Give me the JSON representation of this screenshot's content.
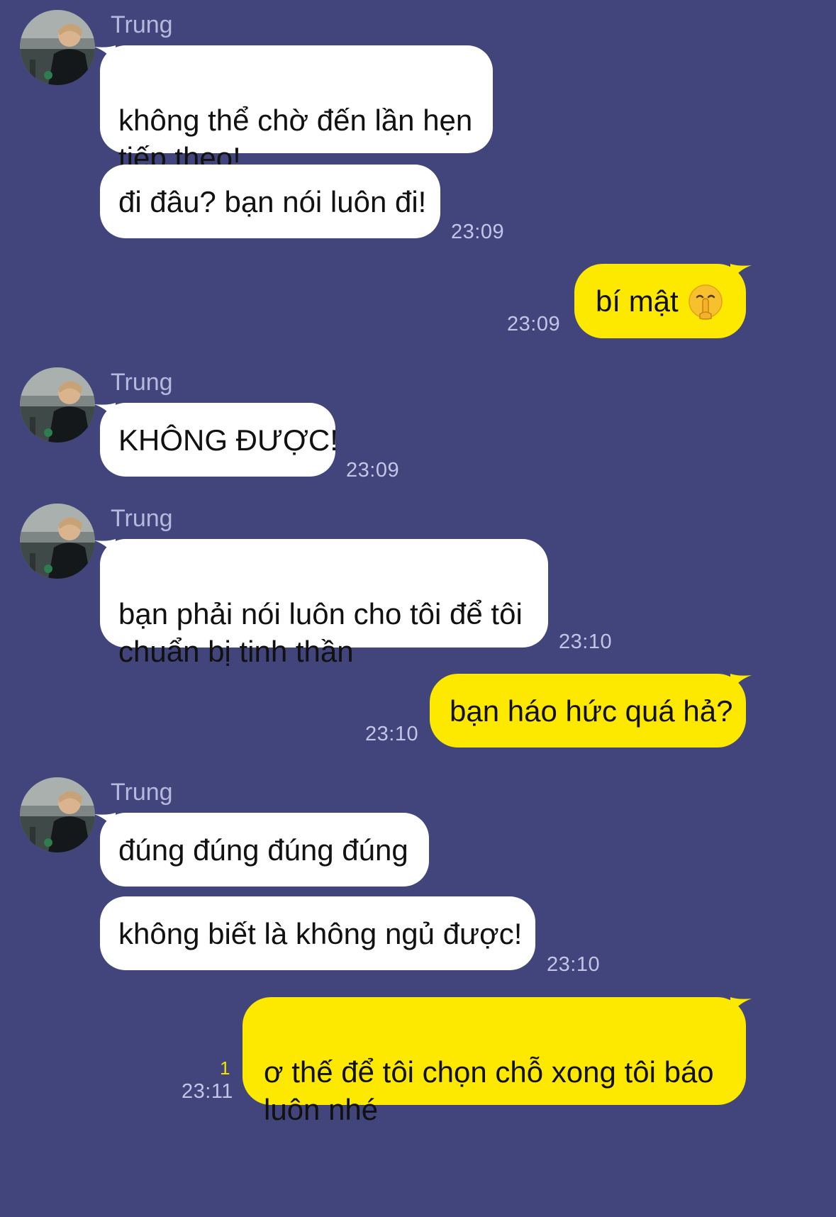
{
  "chat": {
    "contact_name": "Trung",
    "messages": [
      {
        "id": "m1",
        "from": "Trung",
        "text": "không thể chờ đến lần hẹn\ntiếp theo!"
      },
      {
        "id": "m2",
        "from": "Trung",
        "text": "đi đâu? bạn nói luôn đi!",
        "time": "23:09"
      },
      {
        "id": "m3",
        "from": "me",
        "text": "bí mật",
        "emoji": "shushing-face-icon",
        "time": "23:09"
      },
      {
        "id": "m4",
        "from": "Trung",
        "text": "KHÔNG ĐƯỢC!",
        "time": "23:09"
      },
      {
        "id": "m5",
        "from": "Trung",
        "text": "bạn phải nói luôn cho tôi để tôi\nchuẩn bị tinh thần",
        "time": "23:10"
      },
      {
        "id": "m6",
        "from": "me",
        "text": "bạn háo hức quá hả?",
        "time": "23:10"
      },
      {
        "id": "m7",
        "from": "Trung",
        "text": "đúng đúng đúng đúng"
      },
      {
        "id": "m8",
        "from": "Trung",
        "text": "không biết là không ngủ được!",
        "time": "23:10"
      },
      {
        "id": "m9",
        "from": "me",
        "text": "ơ thế để tôi chọn chỗ xong tôi báo\nluôn nhé",
        "time": "23:11",
        "read_count": "1"
      }
    ]
  },
  "colors": {
    "background": "#41457b",
    "incoming_bubble": "#ffffff",
    "outgoing_bubble": "#fde800",
    "timestamp": "#c2c5e6",
    "sender_name": "#b5b9dd",
    "read_count": "#f4e200"
  }
}
